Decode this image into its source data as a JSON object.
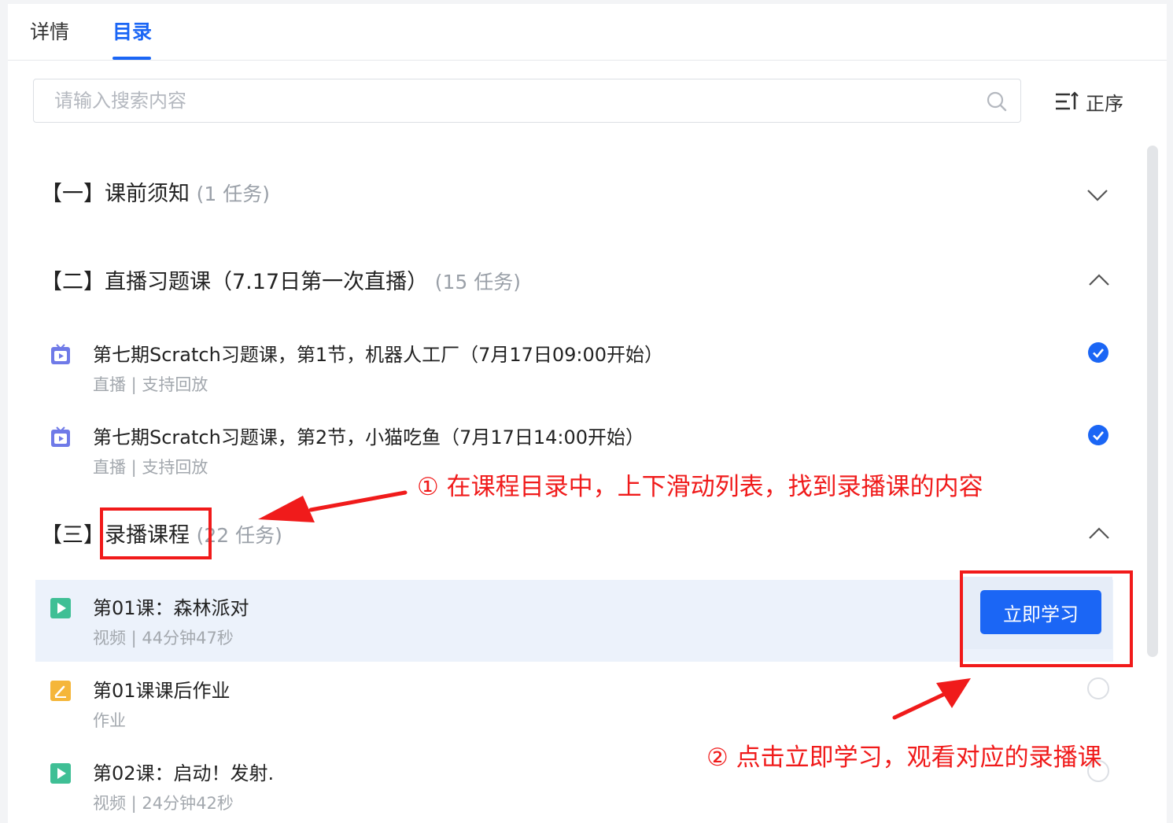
{
  "tabs": [
    {
      "label": "详情"
    },
    {
      "label": "目录"
    }
  ],
  "search": {
    "placeholder": "请输入搜索内容"
  },
  "sort": {
    "label": "正序"
  },
  "chapters": [
    {
      "label": "【一】课前须知",
      "count": "(1 任务)"
    },
    {
      "label": "【二】直播习题课（7.17日第一次直播）",
      "count": "(15 任务)"
    },
    {
      "label": "【三】录播课程",
      "count": "(22 任务)"
    }
  ],
  "items": [
    {
      "title": "第七期Scratch习题课，第1节，机器人工厂（7月17日09:00开始）",
      "meta": "直播  | 支持回放"
    },
    {
      "title": "第七期Scratch习题课，第2节，小猫吃鱼（7月17日14:00开始）",
      "meta": "直播  | 支持回放"
    },
    {
      "title": "第01课：森林派对",
      "meta": "视频  | 44分钟47秒"
    },
    {
      "title": "第01课课后作业",
      "meta": "作业"
    },
    {
      "title": "第02课：启动！发射.",
      "meta": "视频  | 24分钟42秒"
    }
  ],
  "learn_button": {
    "label": "立即学习"
  },
  "annotations": {
    "step1": "① 在课程目录中，上下滑动列表，找到录播课的内容",
    "step2": "② 点击立即学习，观看对应的录播课"
  },
  "colors": {
    "accent": "#1b66f5",
    "annotation": "#f01b1b",
    "live_icon": "#6f7ae8",
    "video_icon": "#3fbf95",
    "homework_icon": "#f5b63a"
  }
}
